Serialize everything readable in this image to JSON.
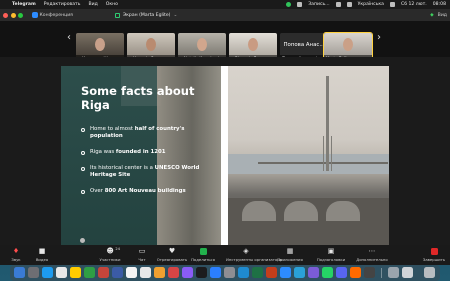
{
  "menubar": {
    "app": "Telegram",
    "items": [
      "Редактировать",
      "Вид",
      "Окно"
    ],
    "status": [
      "Запись...",
      "Українська",
      "Сб 12 лют.",
      "08:08"
    ]
  },
  "window": {
    "conference_label": "Конференция",
    "share_title": "Экран (Marta Eglite)",
    "view_label": "Вид"
  },
  "gallery": {
    "participants": [
      {
        "name": "Катерина Ністенко",
        "muted": true,
        "active": false
      },
      {
        "name": "Наталія Сарада",
        "muted": true,
        "active": false
      },
      {
        "name": "Natalia Kyrychenko",
        "muted": true,
        "active": false
      },
      {
        "name": "Вікторія Дога",
        "muted": true,
        "active": false
      },
      {
        "name": "Попова Анастасія",
        "muted": false,
        "active": false,
        "display": "Попова Анас..."
      },
      {
        "name": "Marta Eglite",
        "muted": false,
        "active": true
      }
    ]
  },
  "slide": {
    "title": "Some facts about Riga",
    "bullets": [
      {
        "text_before": "Home to almost ",
        "bold": "half of country's population",
        "text_after": ""
      },
      {
        "text_before": "Riga was ",
        "bold": "founded in 1201",
        "text_after": ""
      },
      {
        "text_before": "Its historical center is a ",
        "bold": "UNESCO World Heritage Site",
        "text_after": ""
      },
      {
        "text_before": "Over ",
        "bold": "800 Art Nouveau buildings",
        "text_after": ""
      }
    ]
  },
  "toolbar": {
    "items": [
      {
        "label": "Звук",
        "icon": "microphone-muted-icon"
      },
      {
        "label": "Видео",
        "icon": "video-camera-icon"
      },
      {
        "label": "Участники",
        "icon": "participants-icon",
        "count": "24"
      },
      {
        "label": "Чат",
        "icon": "chat-icon"
      },
      {
        "label": "Отреагировать",
        "icon": "reaction-icon"
      },
      {
        "label": "Поделиться",
        "icon": "share-screen-icon"
      },
      {
        "label": "Инструменты организатора",
        "icon": "host-tools-icon"
      },
      {
        "label": "Приложения",
        "icon": "apps-icon"
      },
      {
        "label": "Подзаголовки",
        "icon": "captions-icon"
      },
      {
        "label": "Дополнительно",
        "icon": "more-icon"
      }
    ],
    "end_label": "Завершить"
  },
  "colors": {
    "menubar_bg": "#1a1a1a",
    "window_bg": "#1b1b1b",
    "slide_green": "#2d4e4b",
    "active_speaker": "#ffd23f",
    "end_red": "#e02828",
    "share_green": "#22b14c"
  }
}
